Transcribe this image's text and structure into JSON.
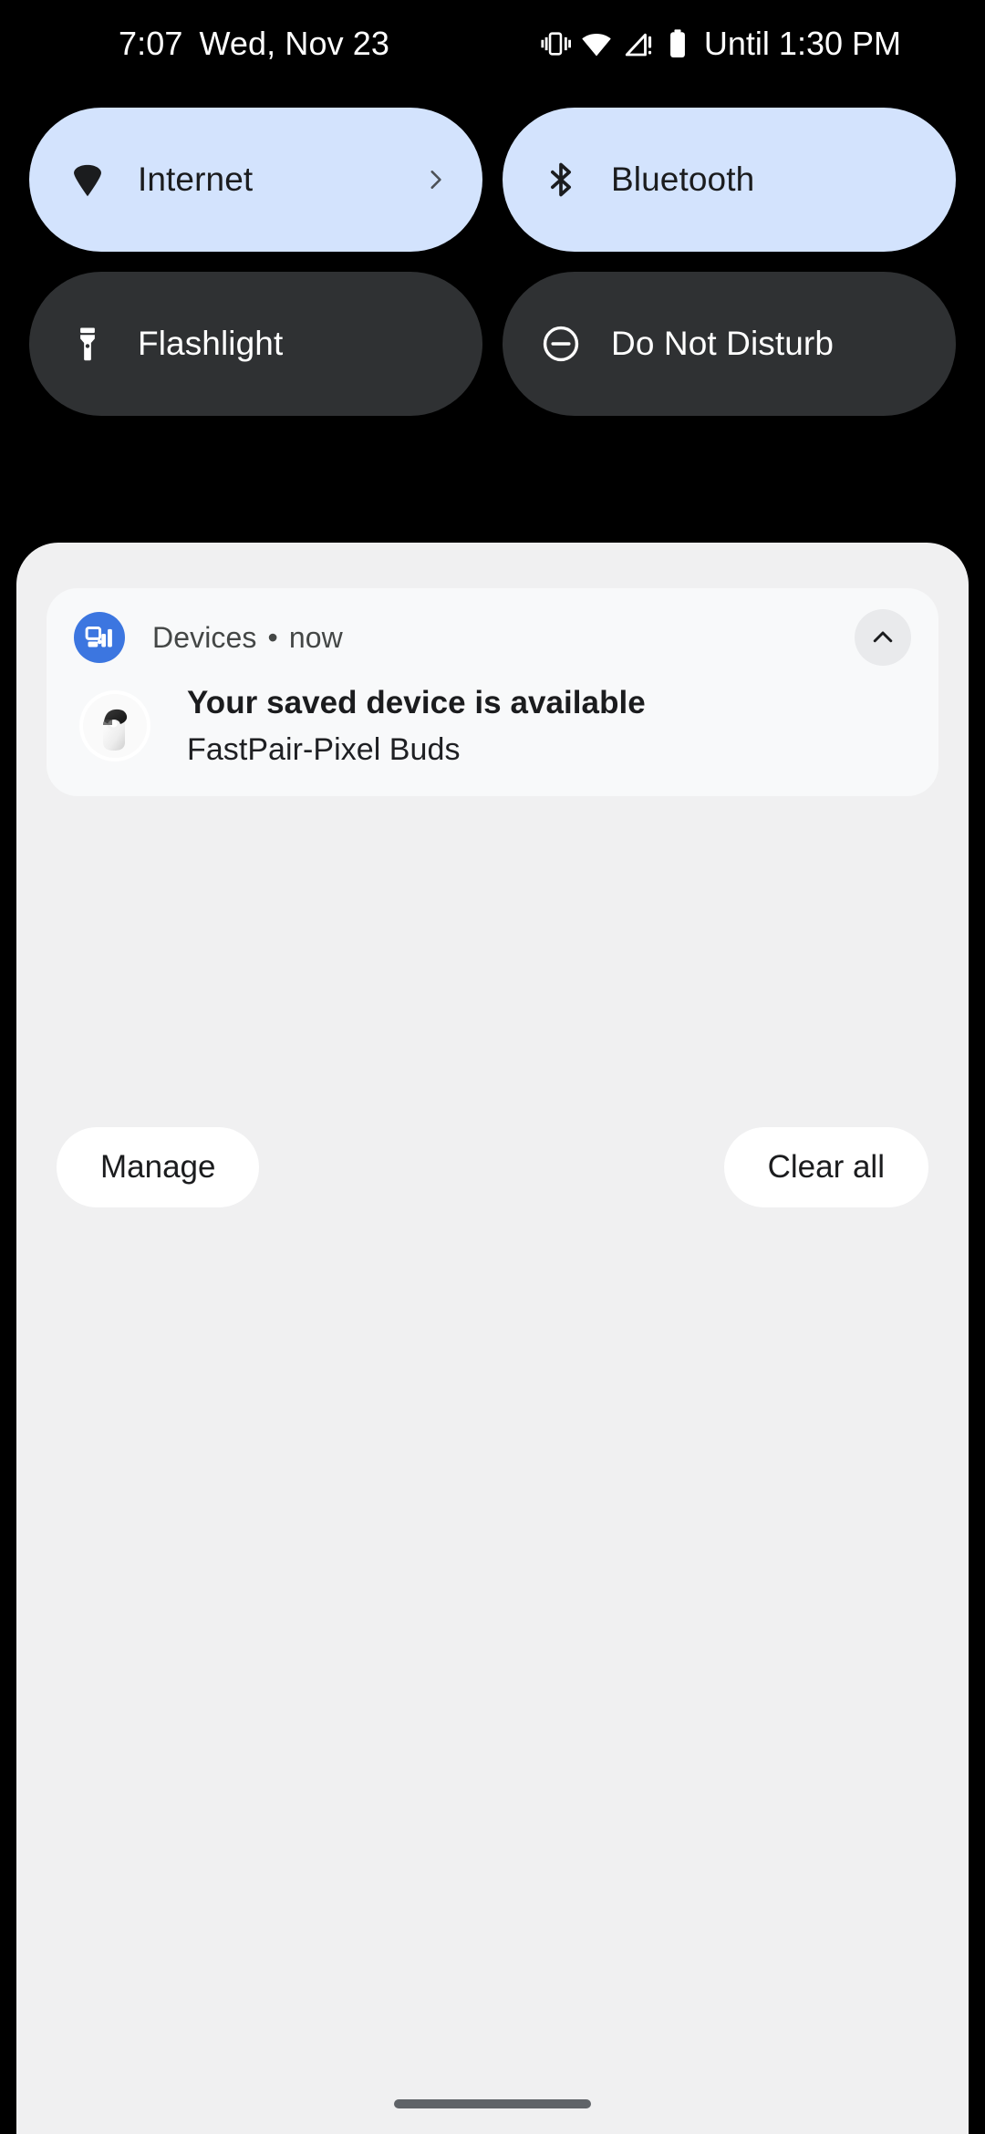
{
  "status_bar": {
    "time": "7:07",
    "date": "Wed, Nov 23",
    "dnd_until": "Until 1:30 PM",
    "icons": [
      "vibrate-icon",
      "wifi-icon",
      "cellular-no-sim-icon",
      "battery-icon"
    ]
  },
  "quick_settings": {
    "tiles": [
      {
        "label": "Internet",
        "icon": "wifi-icon",
        "state": "on",
        "has_chevron": true
      },
      {
        "label": "Bluetooth",
        "icon": "bluetooth-icon",
        "state": "on",
        "has_chevron": false
      },
      {
        "label": "Flashlight",
        "icon": "flashlight-icon",
        "state": "off",
        "has_chevron": false
      },
      {
        "label": "Do Not Disturb",
        "icon": "do-not-disturb-icon",
        "state": "off",
        "has_chevron": false
      }
    ],
    "colors": {
      "tile_on_bg": "#d3e3fd",
      "tile_off_bg": "#2f3133",
      "tile_on_fg": "#1b1c1e",
      "tile_off_fg": "#ffffff"
    }
  },
  "shade": {
    "background": "#f0f0f1",
    "notification": {
      "app_name": "Devices",
      "separator": "•",
      "time": "now",
      "app_icon": "devices-icon",
      "app_icon_color": "#3c76e0",
      "expand_icon": "chevron-up-icon",
      "device_image": "pixel-buds-case-image",
      "title": "Your saved device is available",
      "subtitle": "FastPair-Pixel Buds"
    },
    "actions": {
      "manage_label": "Manage",
      "clear_all_label": "Clear all"
    }
  },
  "navigation": {
    "gesture_bar": "home-gesture-bar"
  }
}
